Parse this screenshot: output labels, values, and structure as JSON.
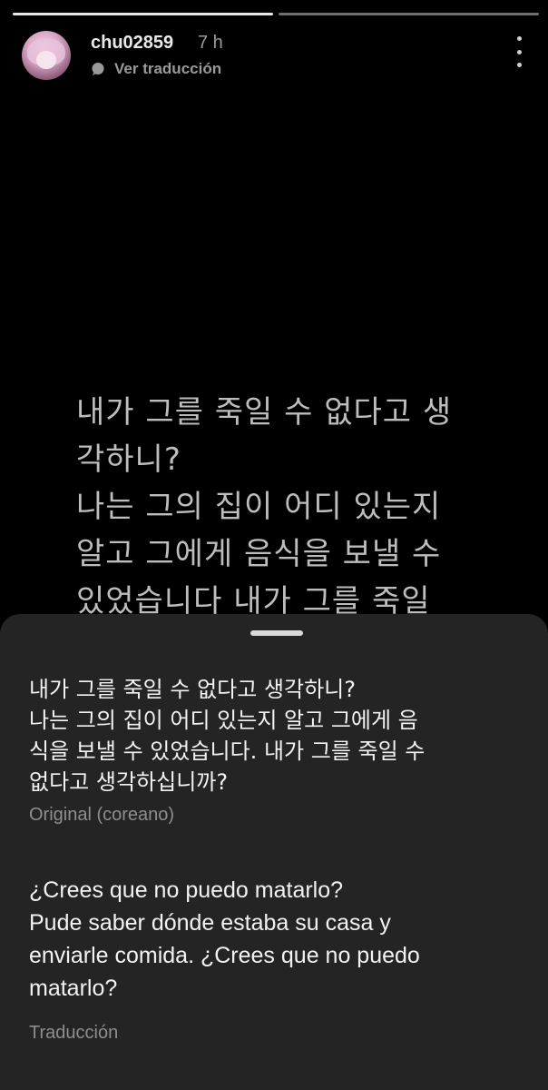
{
  "story": {
    "progress_segments": [
      {
        "state": "done"
      },
      {
        "state": "pending"
      }
    ],
    "username": "chu02859",
    "time": "7 h",
    "translate_link": "Ver traducción",
    "text": "내가 그를 죽일 수 없다고 생\n각하니?\n나는 그의 집이 어디 있는지\n알고 그에게 음식을 보낼 수\n있었습니다 내가 그를 죽일"
  },
  "translation_sheet": {
    "original_text": "내가 그를 죽일 수 없다고 생각하니?\n나는 그의 집이 어디 있는지 알고 그에게 음\n식을 보낼 수 있었습니다. 내가 그를 죽일 수\n없다고 생각하십니까?",
    "original_label": "Original (coreano)",
    "translated_text": "¿Crees que no puedo matarlo?\nPude saber dónde estaba su casa y\nenviarle comida. ¿Crees que no puedo\nmatarlo?",
    "translated_label": "Traducción"
  },
  "colors": {
    "background": "#000000",
    "sheet_background": "#242424",
    "muted_text": "#8e8e8e"
  },
  "icons": {
    "translate": "speech-bubble-icon",
    "more": "more-vertical-icon"
  }
}
